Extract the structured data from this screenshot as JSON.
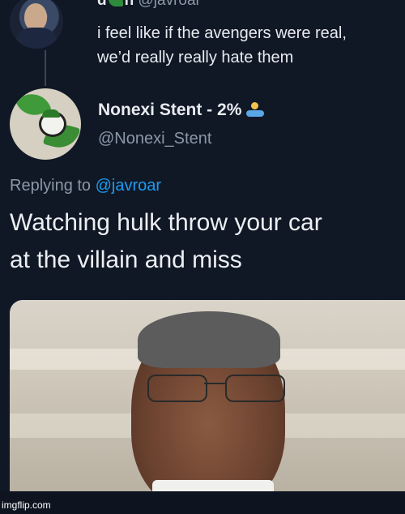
{
  "top_tweet": {
    "name_prefix": "d",
    "name_suffix": "n",
    "handle": "@javroar",
    "text": "i feel like if the avengers were real,\nwe’d really really hate them"
  },
  "reply_tweet": {
    "name": "Nonexi Stent - 2%",
    "handle": "@Nonexi_Stent",
    "replying_prefix": "Replying to",
    "replying_to": "@javroar",
    "text": "Watching hulk throw your car\nat the villain and miss"
  },
  "watermark": "imgflip.com",
  "colors": {
    "background": "#101826",
    "mention": "#1d9bf0",
    "secondary_text": "#8b98a5"
  }
}
